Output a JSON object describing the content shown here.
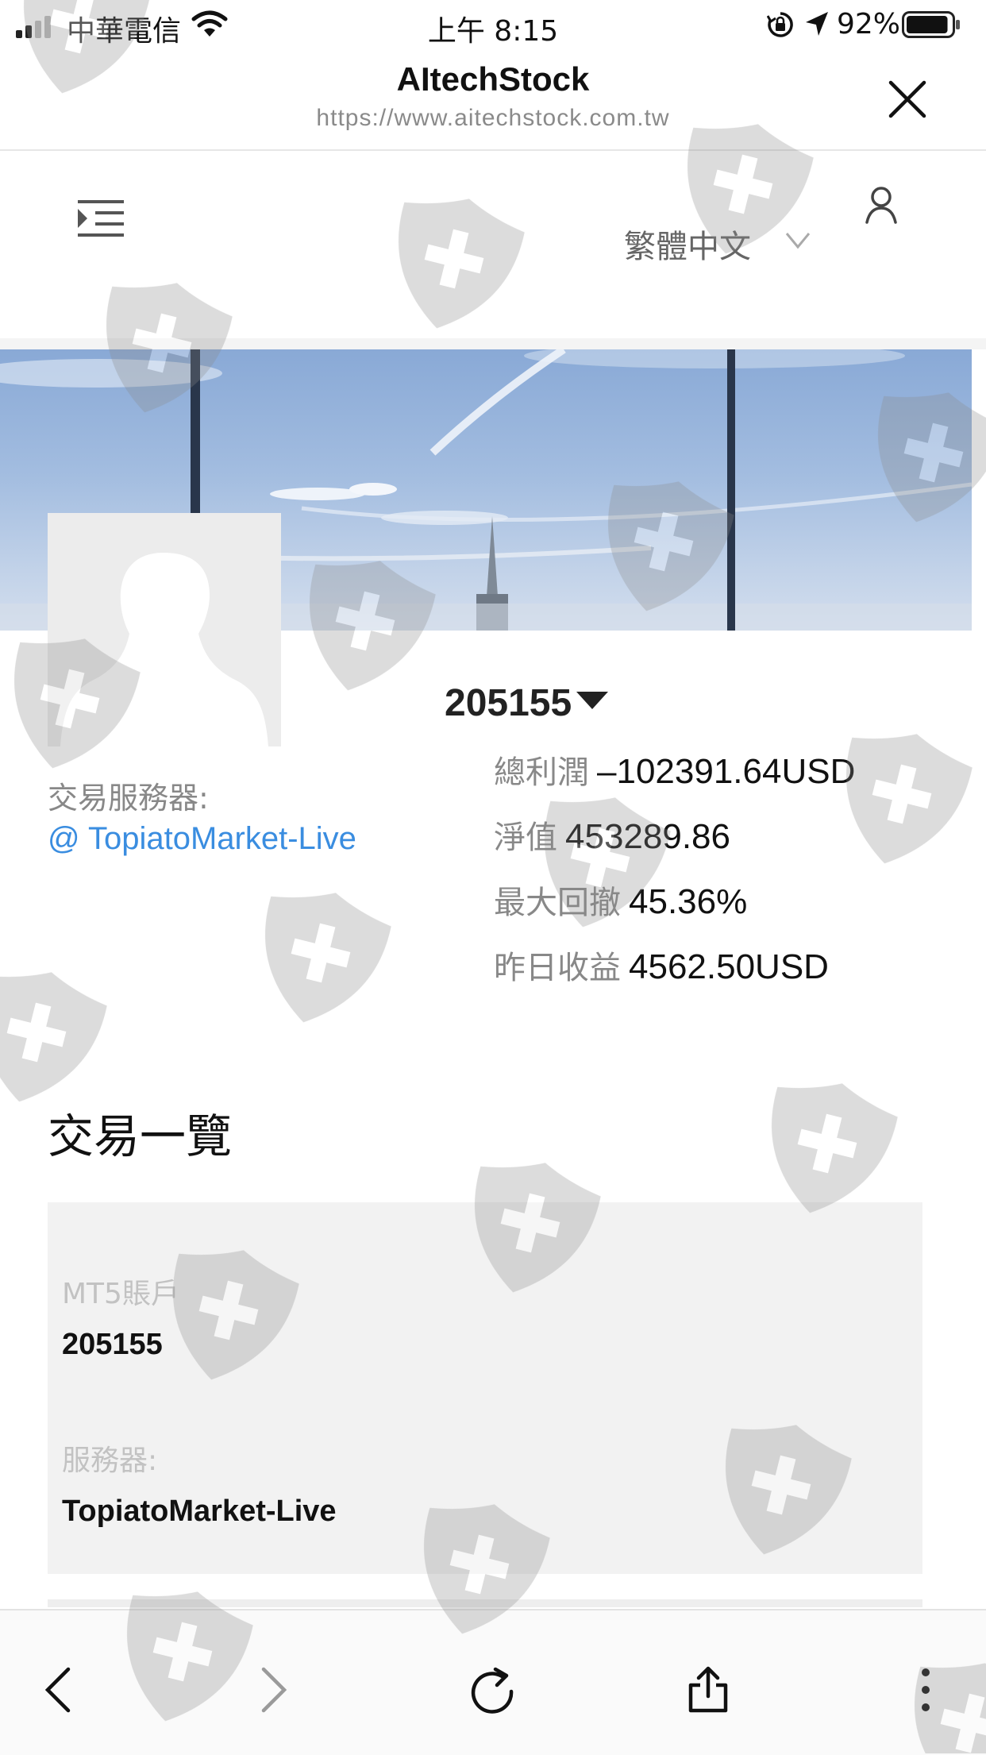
{
  "status_bar": {
    "carrier": "中華電信",
    "time": "上午 8:15",
    "battery_percent": "92%",
    "battery_level": 0.92,
    "icons": [
      "signal-icon",
      "wifi-icon",
      "orientation-lock-icon",
      "location-arrow-icon",
      "battery-icon"
    ]
  },
  "browser": {
    "title": "AItechStock",
    "url": "https://www.aitechstock.com.tw",
    "close_icon": "close-icon"
  },
  "nav": {
    "menu_icon": "menu-indent-icon",
    "language": "繁體中文",
    "language_icon": "chevron-down-icon",
    "user_icon": "user-icon"
  },
  "profile": {
    "server_label": "交易服務器:",
    "server_link": "@ TopiatoMarket-Live",
    "account_number": "205155",
    "stats": [
      {
        "label": "總利潤",
        "value": "–102391.64USD"
      },
      {
        "label": "淨值",
        "value": "453289.86"
      },
      {
        "label": "最大回撤",
        "value": "45.36%"
      },
      {
        "label": "昨日收益",
        "value": "4562.50USD"
      }
    ]
  },
  "trades": {
    "title": "交易一覽",
    "card": {
      "account_label": "MT5賬戶",
      "account_value": "205155",
      "server_label": "服務器:",
      "server_value": "TopiatoMarket-Live"
    }
  },
  "toolbar": {
    "icons": [
      "back-icon",
      "forward-icon",
      "reload-icon",
      "share-icon",
      "more-icon"
    ]
  },
  "theme": {
    "link_color": "#3a8de0",
    "card_background": "#f2f2f2",
    "muted_text": "#888888"
  }
}
